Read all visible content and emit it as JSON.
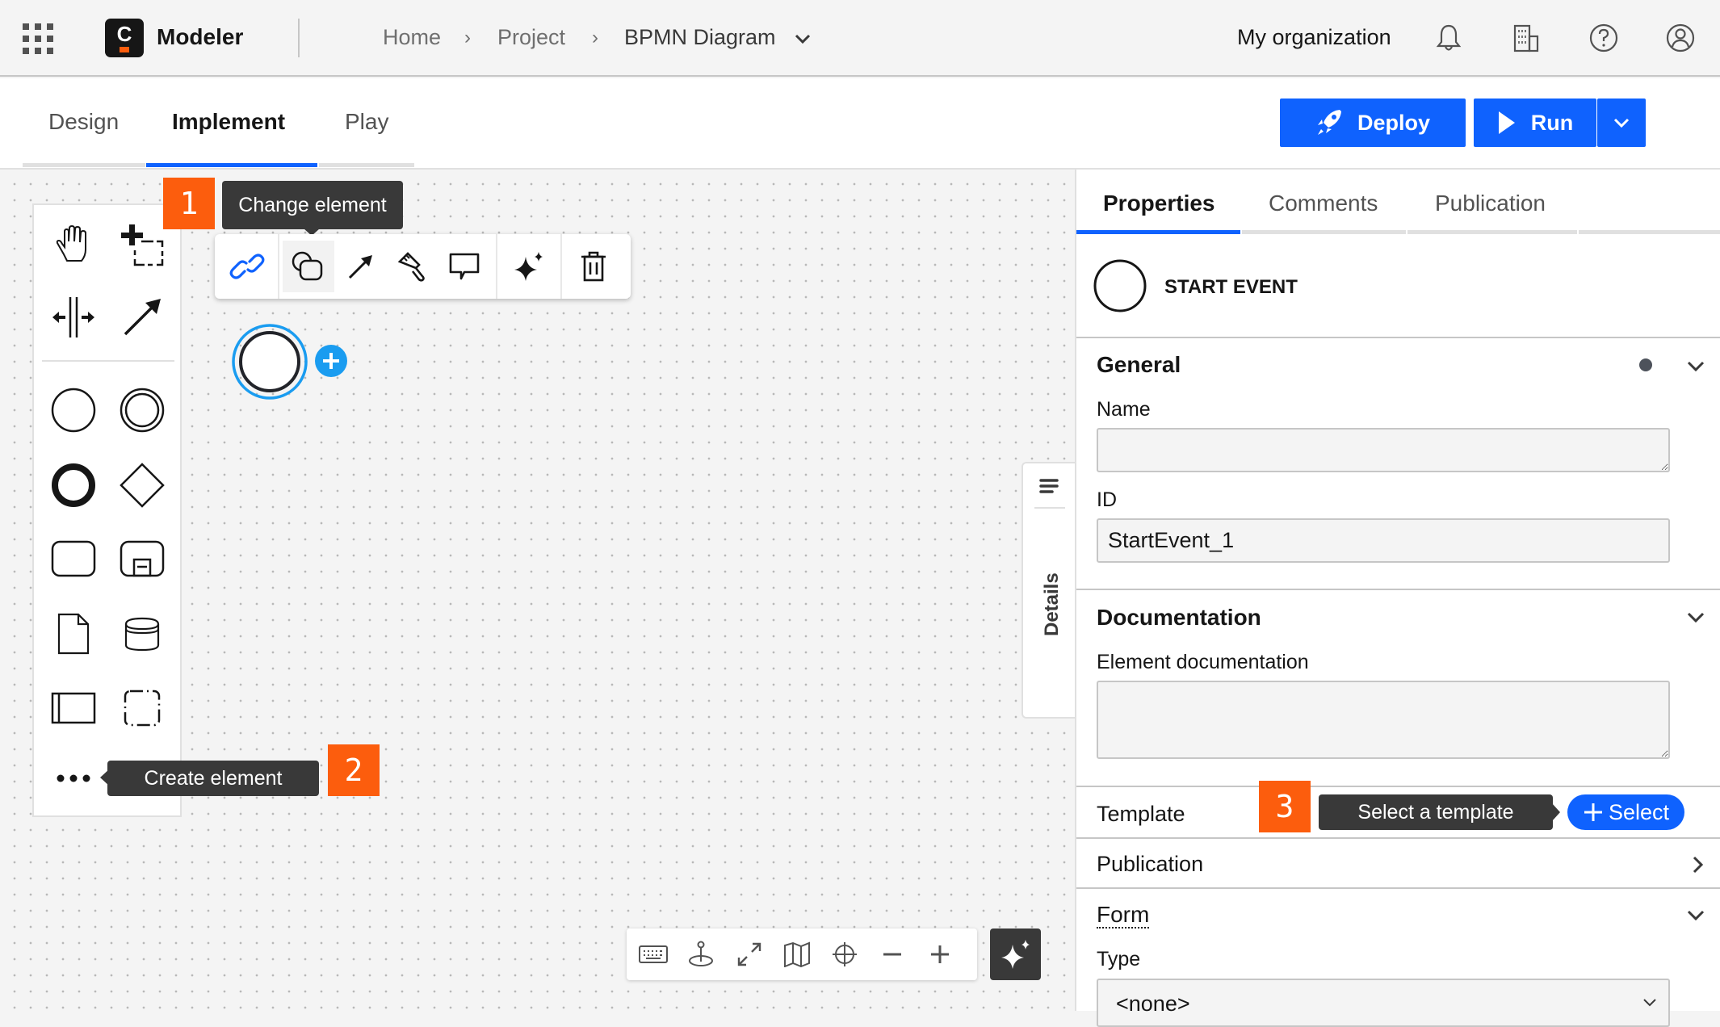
{
  "header": {
    "app_grid_icon": "app-switcher-grid-icon",
    "logo_letter": "C",
    "app_name": "Modeler",
    "breadcrumb": [
      {
        "label": "Home"
      },
      {
        "label": "Project"
      },
      {
        "label": "BPMN Diagram"
      }
    ],
    "breadcrumb_separator": "›",
    "organization": "My organization",
    "icons": [
      "bell-icon",
      "building-icon",
      "help-icon",
      "user-avatar-icon"
    ]
  },
  "mode_tabs": [
    {
      "label": "Design",
      "active": false
    },
    {
      "label": "Implement",
      "active": true
    },
    {
      "label": "Play",
      "active": false
    }
  ],
  "actions": {
    "deploy_label": "Deploy",
    "run_label": "Run"
  },
  "palette": {
    "tools": [
      "hand-tool",
      "lasso-tool",
      "space-tool",
      "connect-tool"
    ],
    "elements": [
      "start-event",
      "intermediate-event",
      "end-event",
      "gateway",
      "task",
      "subprocess",
      "data-object",
      "data-store",
      "pool",
      "group"
    ],
    "more_label": "Create element"
  },
  "annotations": [
    {
      "number": "1",
      "text": "Change element"
    },
    {
      "number": "2",
      "text": "Create element"
    },
    {
      "number": "3",
      "text": "Select a template"
    }
  ],
  "context_pad": [
    "link-icon",
    "change-element-icon",
    "connect-arrow-icon",
    "paint-brush-icon",
    "comment-icon",
    "ai-sparkle-icon",
    "trash-icon"
  ],
  "details_tab": {
    "label": "Details"
  },
  "canvas_controls": [
    "keyboard-icon",
    "reset-view-icon",
    "fullscreen-icon",
    "minimap-icon",
    "crosshair-icon",
    "zoom-out-icon",
    "zoom-in-icon"
  ],
  "panel": {
    "tabs": [
      {
        "label": "Properties",
        "active": true
      },
      {
        "label": "Comments",
        "active": false
      },
      {
        "label": "Publication",
        "active": false
      }
    ],
    "element_type": "START EVENT",
    "general": {
      "title": "General",
      "name_label": "Name",
      "name_value": "",
      "id_label": "ID",
      "id_value": "StartEvent_1"
    },
    "documentation": {
      "title": "Documentation",
      "label": "Element documentation",
      "value": ""
    },
    "template": {
      "label": "Template",
      "button_label": "Select"
    },
    "publication": {
      "title": "Publication"
    },
    "form": {
      "title": "Form",
      "type_label": "Type",
      "type_value": "<none>"
    }
  },
  "colors": {
    "accent": "#0f62fe",
    "annotation_badge": "#fc5d0d",
    "tooltip_bg": "#393939",
    "selection": "#1a9cf0"
  }
}
